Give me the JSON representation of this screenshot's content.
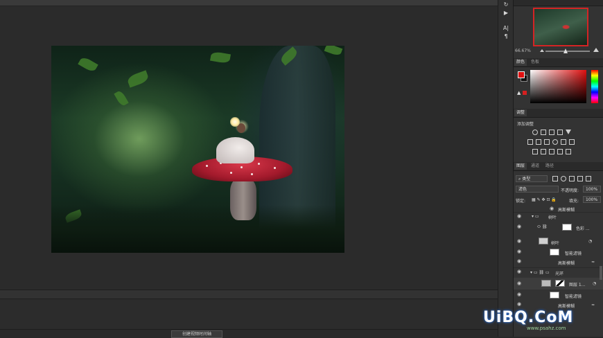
{
  "navigator": {
    "zoom": "66.67%"
  },
  "color_panel": {
    "tabs": [
      "颜色",
      "色板"
    ],
    "fg": "#e01010",
    "bg": "#111111"
  },
  "adjustments": {
    "tab": "调整",
    "label": "添加调整"
  },
  "layers": {
    "tabs": [
      "图层",
      "通道",
      "路径"
    ],
    "kind": "类型",
    "blend": "滤色",
    "opacity_label": "不透明度:",
    "opacity": "100%",
    "lock_label": "锁定:",
    "fill_label": "填充:",
    "fill": "100%",
    "rows": [
      "高斯模糊",
      "树叶",
      "色彩 ...",
      "树叶",
      "智能滤镜",
      "高斯模糊",
      "光环",
      "图层 1...",
      "智能滤镜",
      "高斯模糊"
    ]
  },
  "timeline": {
    "create_label": "创建视频时间轴"
  },
  "watermark": {
    "text": "UiBQ.CoM",
    "sub": "www.psahz.com"
  }
}
